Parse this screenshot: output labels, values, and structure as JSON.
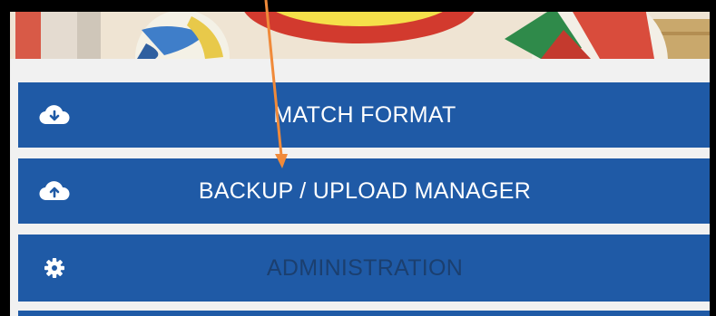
{
  "menu": {
    "items": [
      {
        "label": "MATCH FORMAT",
        "icon": "cloud-download-icon",
        "enabled": true
      },
      {
        "label": "BACKUP / UPLOAD MANAGER",
        "icon": "cloud-upload-icon",
        "enabled": true
      },
      {
        "label": "ADMINISTRATION",
        "icon": "gear-icon",
        "enabled": false
      }
    ]
  },
  "colors": {
    "menu_background": "#1f5aa6",
    "icon_and_text": "#ffffff",
    "disabled_text": "#1b3f6f",
    "annotation_arrow": "#f08a3a"
  }
}
